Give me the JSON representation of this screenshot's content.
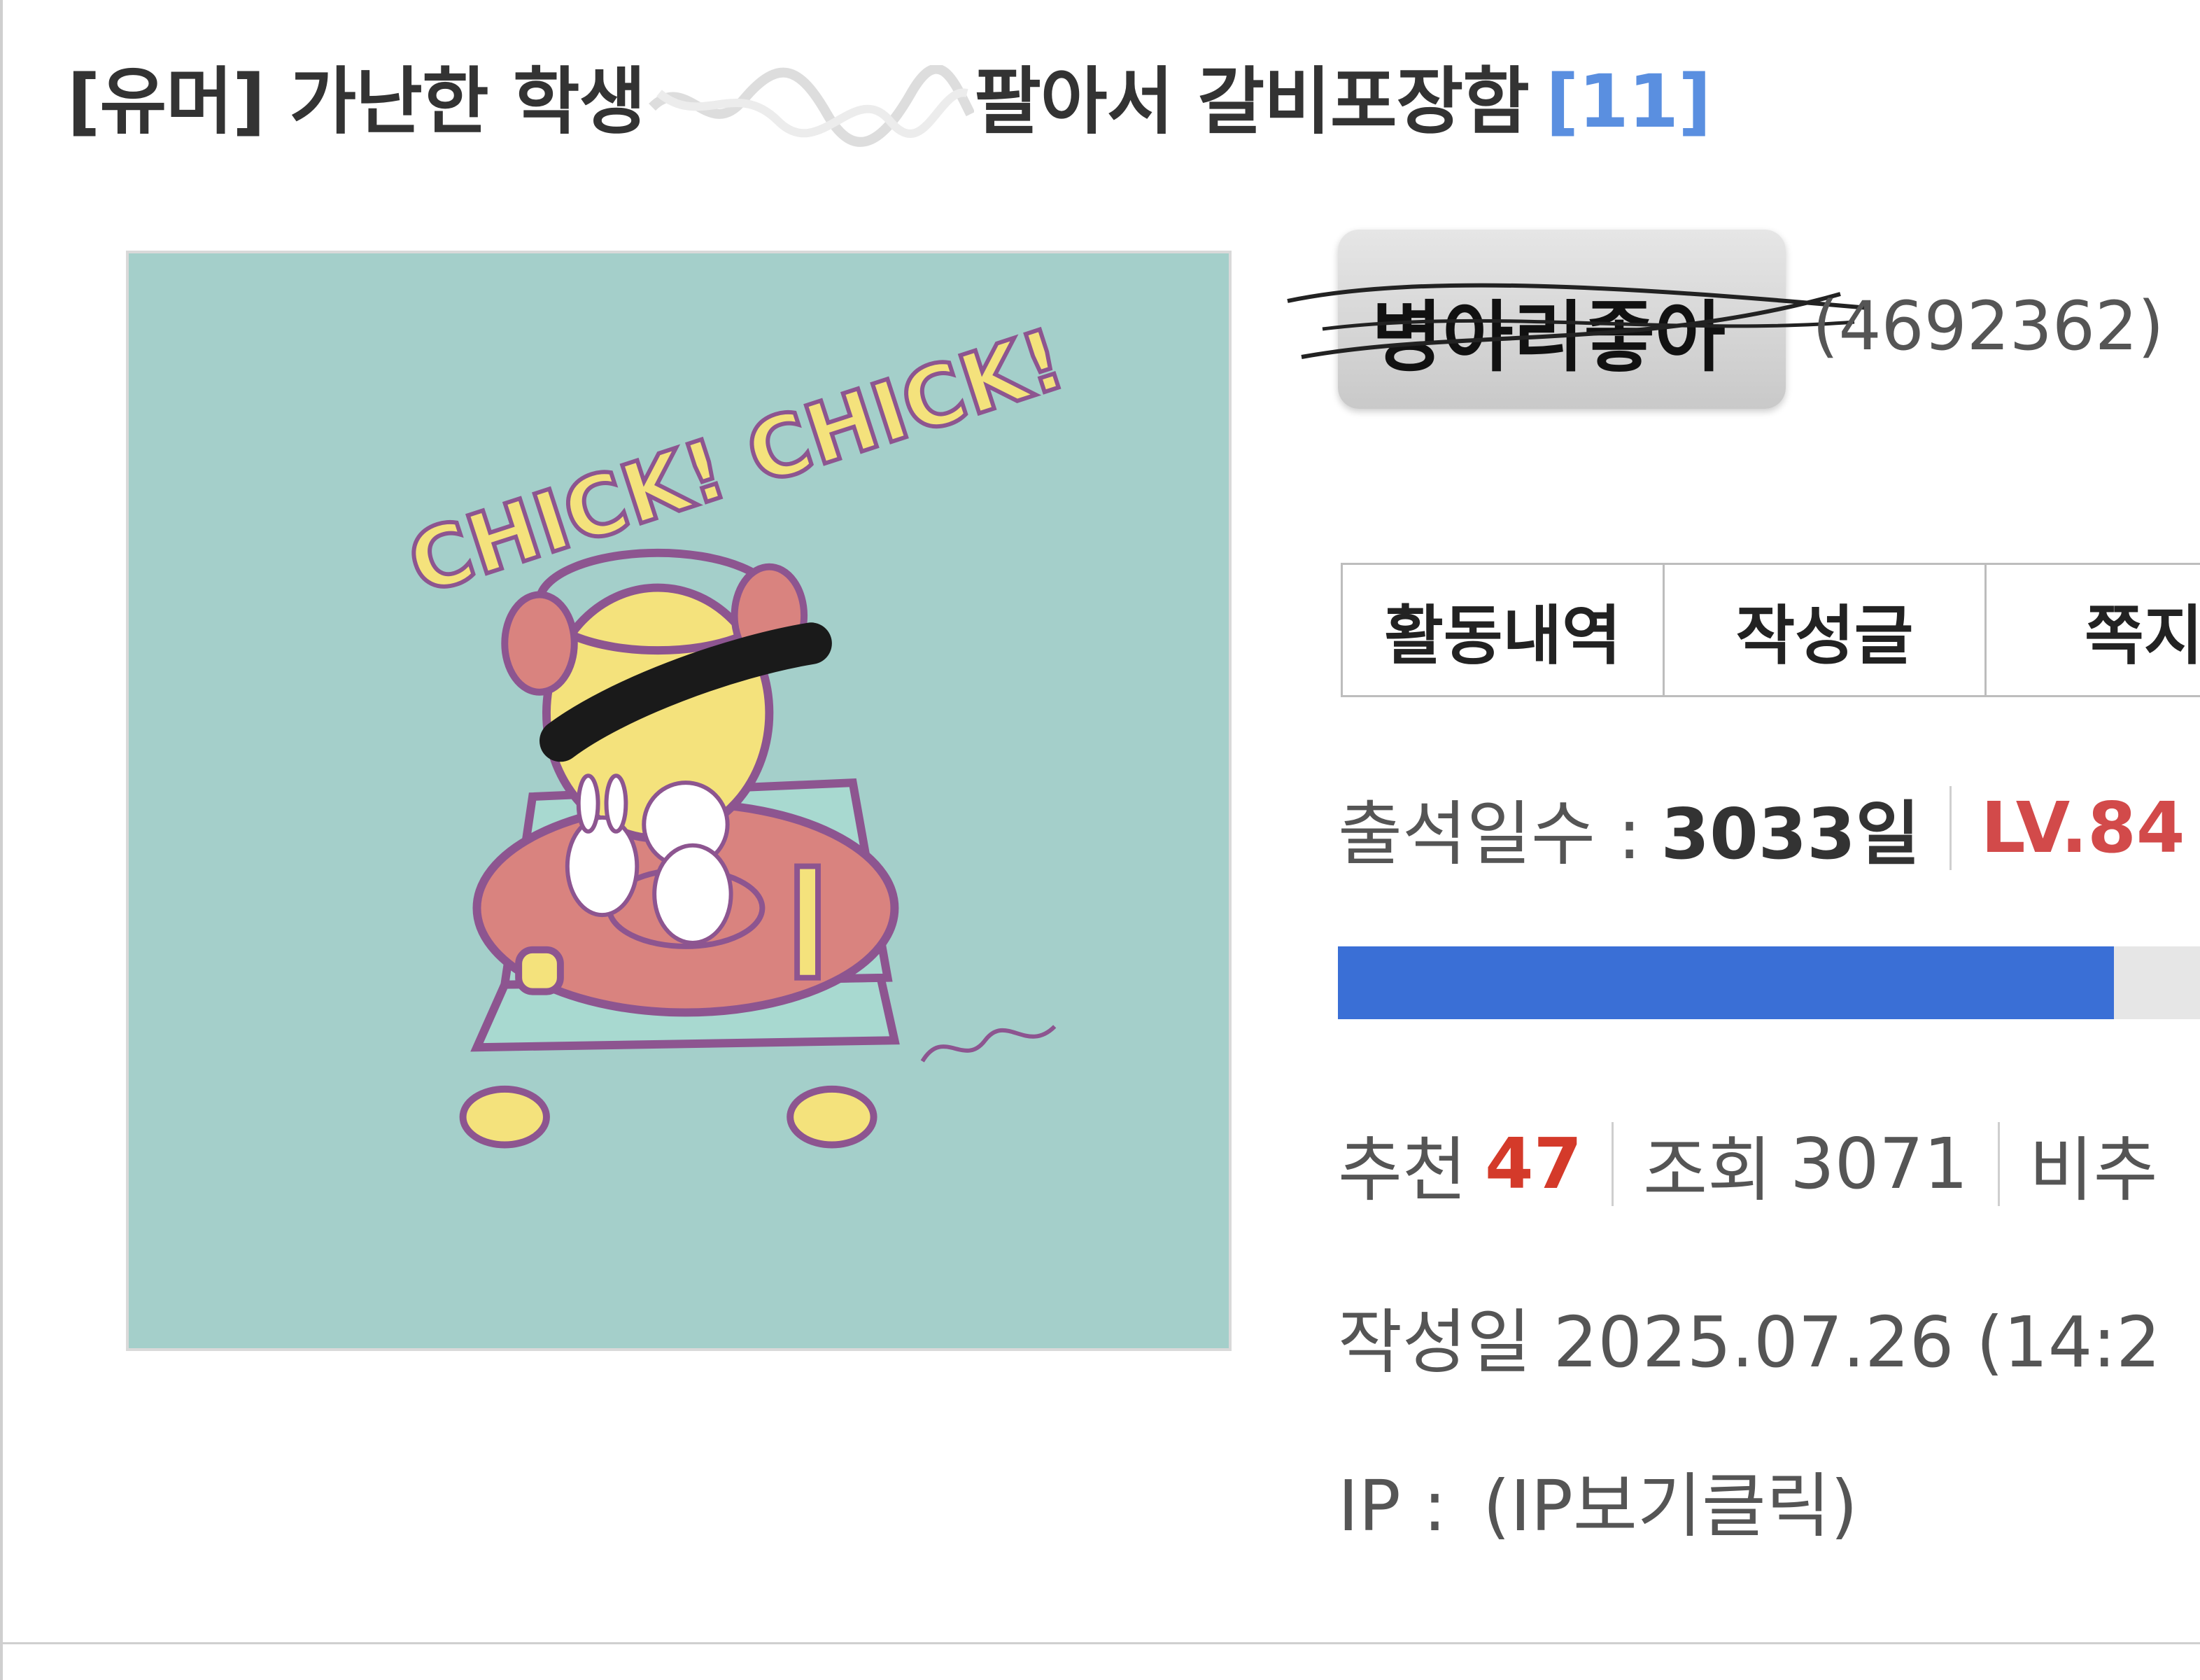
{
  "post": {
    "title_prefix": "[유머] 가난한 학생",
    "title_suffix": "팔아서 갈비포장함",
    "comment_count": "[11]"
  },
  "profile": {
    "image_text": "CHICK! CHICK!",
    "nickname": "병아리좋아",
    "member_id": "(4692362)"
  },
  "tabs": [
    "활동내역",
    "작성글",
    "쪽지"
  ],
  "attendance": {
    "label": "출석일수 :",
    "days": "3033일",
    "level": "LV.84"
  },
  "progress": {
    "fraction": 0.9
  },
  "stats": {
    "recommend_label": "추천",
    "recommend_value": "47",
    "views_label": "조회",
    "views_value": "3071",
    "extra_label": "비추"
  },
  "date_row": {
    "text": "작성일 2025.07.26 (14:2"
  },
  "ip_row": {
    "label": "IP :",
    "link": "(IP보기클릭)"
  },
  "colors": {
    "accent_blue": "#3a6fd6",
    "comment_count": "#5a8fe0",
    "level_red": "#d24a4a",
    "recommend_red": "#d43a2a",
    "image_bg": "#a4cfca"
  }
}
